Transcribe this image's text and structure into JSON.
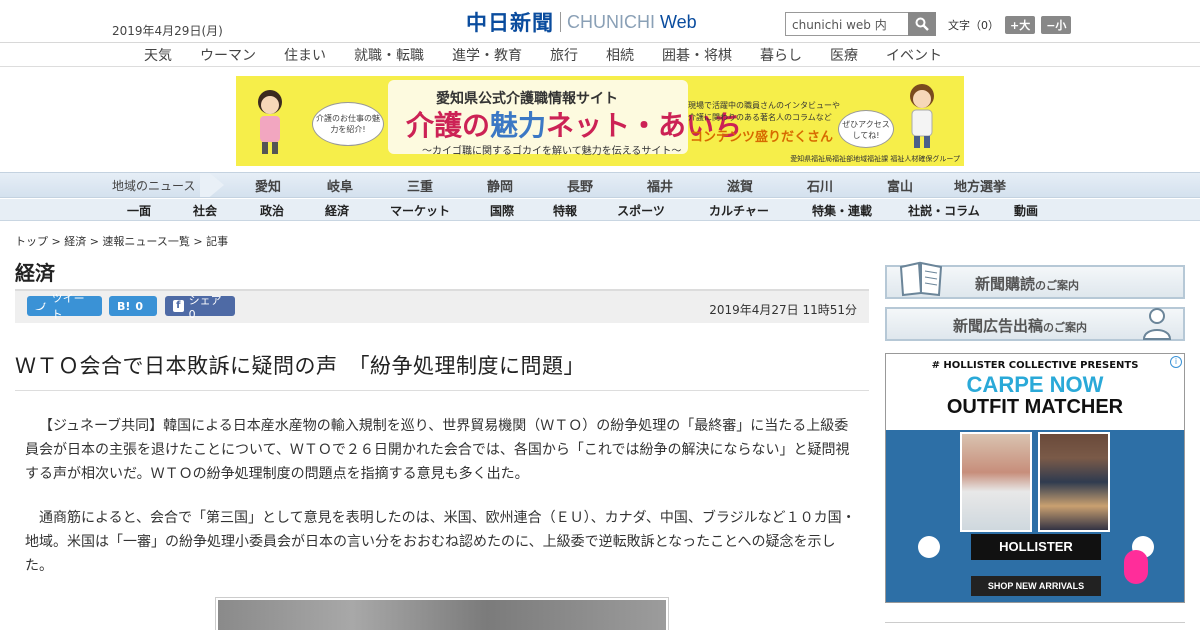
{
  "header": {
    "date": "2019年4月29日(月)",
    "logo_kanji": "中日新聞",
    "logo_latin": "CHUNICHI",
    "logo_web": "Web",
    "search_placeholder": "chunichi web 内",
    "font_label": "文字（0）",
    "font_bigger": "+大",
    "font_smaller": "−小"
  },
  "global_nav": [
    "天気",
    "ウーマン",
    "住まい",
    "就職・転職",
    "進学・教育",
    "旅行",
    "相続",
    "囲碁・将棋",
    "暮らし",
    "医療",
    "イベント"
  ],
  "ad_banner": {
    "title": "愛知県公式介護職情報サイト",
    "main_a": "介護の",
    "main_b": "魅力",
    "main_c": "ネット・あいち",
    "subtitle": "〜カイゴ職に関するゴカイを解いて魅力を伝えるサイト〜",
    "right_text_1": "現場で活躍中の職員さんのインタビューや",
    "right_text_2": "介護に関わりのある著名人のコラムなど",
    "right_highlight": "コンテンツ盛りだくさん",
    "bubble_left": "介護のお仕事の魅力を紹介!",
    "bubble_right": "ぜひアクセスしてね!",
    "footer": "愛知県福祉局福祉部地域福祉課 福祉人材確保グループ"
  },
  "region_nav": {
    "label": "地域のニュース",
    "items": [
      "愛知",
      "岐阜",
      "三重",
      "静岡",
      "長野",
      "福井",
      "滋賀",
      "石川",
      "富山",
      "地方選挙"
    ]
  },
  "category_nav": [
    "一面",
    "社会",
    "政治",
    "経済",
    "マーケット",
    "国際",
    "特報",
    "スポーツ",
    "カルチャー",
    "特集・連載",
    "社説・コラム",
    "動画"
  ],
  "breadcrumb": "トップ > 経済 > 速報ニュース一覧 > 記事",
  "section_title": "経済",
  "share": {
    "tweet": "ツイート",
    "hatena": "0",
    "facebook": "シェア 0"
  },
  "article": {
    "published": "2019年4月27日 11時51分",
    "headline": "ＷＴＯ会合で日本敗訴に疑問の声　「紛争処理制度に問題」",
    "paragraphs": [
      "【ジュネーブ共同】韓国による日本産水産物の輸入規制を巡り、世界貿易機関（ＷＴＯ）の紛争処理の「最終審」に当たる上級委員会が日本の主張を退けたことについて、ＷＴＯで２６日開かれた会合では、各国から「これでは紛争の解決にならない」と疑問視する声が相次いだ。ＷＴＯの紛争処理制度の問題点を指摘する意見も多く出た。",
      "通商筋によると、会合で「第三国」として意見を表明したのは、米国、欧州連合（ＥＵ）、カナダ、中国、ブラジルなど１０カ国・地域。米国は「一審」の紛争処理小委員会が日本の言い分をおおむね認めたのに、上級委で逆転敗訴となったことへの疑念を示した。"
    ]
  },
  "sidebar": {
    "subscribe": "新聞購読",
    "subscribe_small": "のご案内",
    "ad_placement": "新聞広告出稿",
    "ad_placement_small": "のご案内",
    "hollister_presents": "# HOLLISTER COLLECTIVE  PRESENTS",
    "hollister_carpe": "CARPE NOW",
    "hollister_outfit": "OUTFIT MATCHER",
    "hollister_brand": "HOLLISTER",
    "hollister_shop": "SHOP NEW ARRIVALS"
  }
}
